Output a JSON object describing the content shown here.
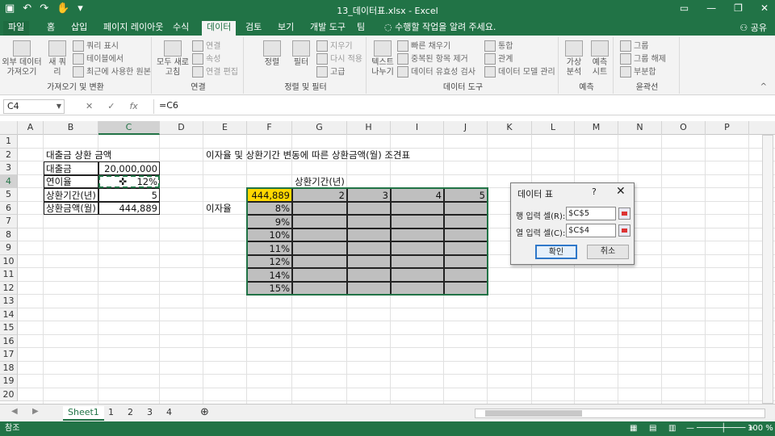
{
  "window": {
    "title": "13_데이터표.xlsx - Excel"
  },
  "tabs": [
    "파일",
    "홈",
    "삽입",
    "페이지 레이아웃",
    "수식",
    "데이터",
    "검토",
    "보기",
    "개발 도구",
    "팀"
  ],
  "tell_me": "수행할 작업을 알려 주세요.",
  "share_label": "공유",
  "ribbon": {
    "get_external": "외부 데이터 가져오기",
    "new_query": "새 쿼리",
    "show_query": "쿼리 표시",
    "from_table": "테이블에서",
    "recent_sources": "최근에 사용한 원본",
    "refresh_all": "모두 새로 고침",
    "connections": "연결",
    "properties": "속성",
    "edit_links": "연결 편집",
    "sort": "정렬",
    "filter": "필터",
    "clear": "지우기",
    "reapply": "다시 적용",
    "advanced": "고급",
    "text_to_columns": "텍스트 나누기",
    "flash_fill": "빠른 채우기",
    "remove_duplicates": "중복된 항목 제거",
    "data_validation": "데이터 유효성 검사",
    "consolidate": "통합",
    "relationships": "관계",
    "data_model": "데이터 모델 관리",
    "what_if": "가상 분석",
    "forecast_sheet": "예측 시트",
    "group": "그룹",
    "ungroup": "그룹 해제",
    "subtotal": "부분합",
    "groups": [
      "가져오기 및 변환",
      "연결",
      "정렬 및 필터",
      "데이터 도구",
      "예측",
      "윤곽선"
    ]
  },
  "formula_bar": {
    "name_box": "C4",
    "formula": "=C6"
  },
  "columns": [
    "A",
    "B",
    "C",
    "D",
    "E",
    "F",
    "G",
    "H",
    "I",
    "J",
    "K",
    "L",
    "M",
    "N",
    "O",
    "P"
  ],
  "rows": [
    "1",
    "2",
    "3",
    "4",
    "5",
    "6",
    "7",
    "8",
    "9",
    "10",
    "11",
    "12",
    "13",
    "14",
    "15",
    "16",
    "17",
    "18",
    "19",
    "20"
  ],
  "sheet": {
    "title_left": "대출금 상환 금액",
    "loan_label": "대출금",
    "loan_value": "20,000,000",
    "rate_label": "연이율",
    "rate_value": "12%",
    "term_label": "상환기간(년)",
    "term_value": "5",
    "payment_label": "상환금액(월)",
    "payment_value": "444,889",
    "title_right": "이자율 및 상환기간 변동에 따른 상환금액(월) 조견표",
    "term_header": "상환기간(년)",
    "rate_axis_label": "이자율",
    "corner_value": "444,889",
    "term_values": [
      "2",
      "3",
      "4",
      "5"
    ],
    "rate_values": [
      "8%",
      "9%",
      "10%",
      "11%",
      "12%",
      "14%",
      "15%"
    ]
  },
  "sheet_tabs": [
    "Sheet1",
    "1",
    "2",
    "3",
    "4"
  ],
  "status": {
    "mode": "참조",
    "zoom": "100 %"
  },
  "dialog": {
    "title": "데이터 표",
    "help": "?",
    "row_label": "행 입력 셀(R):",
    "row_value": "$C$5",
    "col_label": "열 입력 셀(C):",
    "col_value": "$C$4",
    "ok": "확인",
    "cancel": "취소"
  }
}
